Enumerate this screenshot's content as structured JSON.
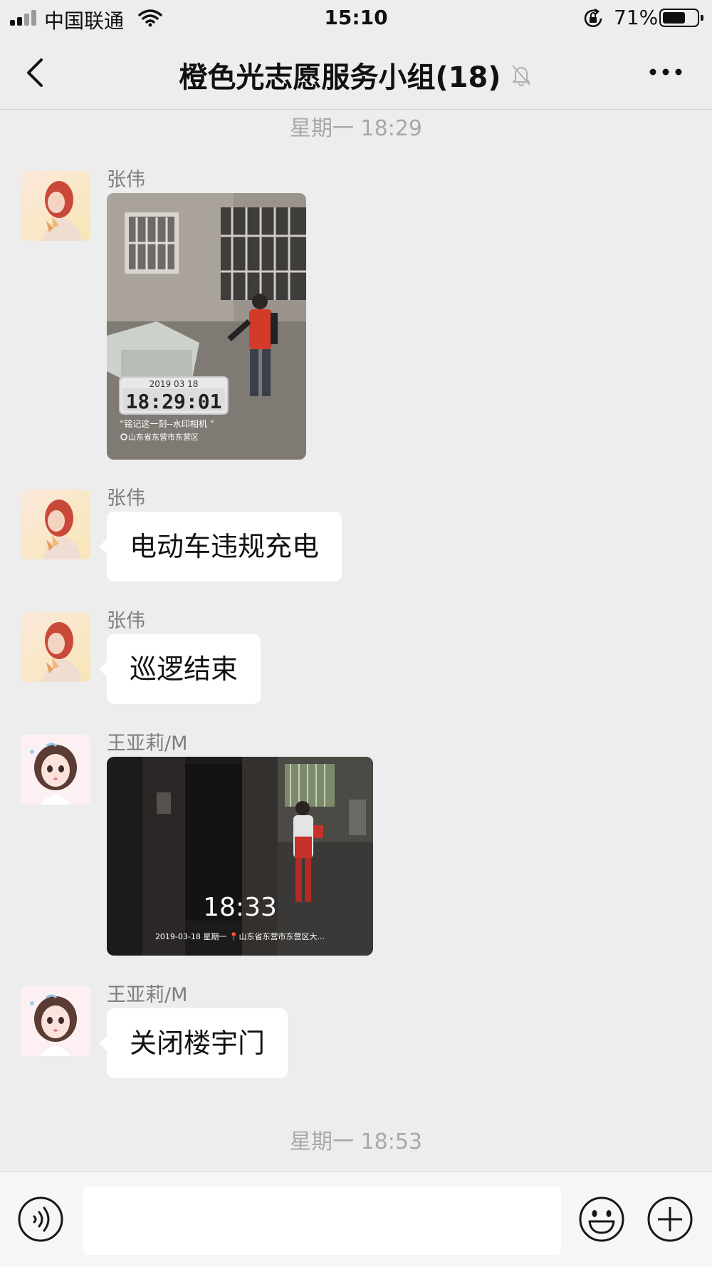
{
  "status_bar": {
    "carrier": "中国联通",
    "time": "15:10",
    "battery_percent": "71%",
    "battery_level": 0.71,
    "icons": [
      "signal-icon",
      "wifi-icon",
      "orientation-lock-icon",
      "battery-icon"
    ]
  },
  "nav": {
    "back_icon": "chevron-left-icon",
    "title": "橙色光志愿服务小组(18)",
    "mute_icon": "bell-muted-icon",
    "more_icon": "more-dots-icon"
  },
  "messages": [
    {
      "type": "time",
      "text": "星期一 18:29"
    },
    {
      "type": "image",
      "sender": "张伟",
      "avatar": "avatar-red-hair",
      "overlay_date": "2019 03 18",
      "overlay_clock": "18:29:01",
      "overlay_caption": "“铭记这一刻--水印相机 ”",
      "overlay_location": "山东省东营市东营区"
    },
    {
      "type": "text",
      "sender": "张伟",
      "text": "电动车违规充电"
    },
    {
      "type": "text",
      "sender": "张伟",
      "text": "巡逻结束"
    },
    {
      "type": "image",
      "sender": "王亚莉/M",
      "avatar": "avatar-cartoon-girl",
      "overlay_clock": "18:33",
      "overlay_footer": "2019-03-18  星期一 📍山东省东营市东营区大..."
    },
    {
      "type": "text",
      "sender": "王亚莉/M",
      "text": "关闭楼宇门"
    },
    {
      "type": "time",
      "text": "星期一 18:53"
    }
  ],
  "input_bar": {
    "voice_icon": "voice-icon",
    "emoji_icon": "emoji-icon",
    "plus_icon": "plus-icon",
    "text_value": ""
  },
  "colors": {
    "background": "#ededed",
    "bubble": "#ffffff",
    "time_text": "#a8a8a8",
    "sender_text": "#7d7d7d"
  }
}
